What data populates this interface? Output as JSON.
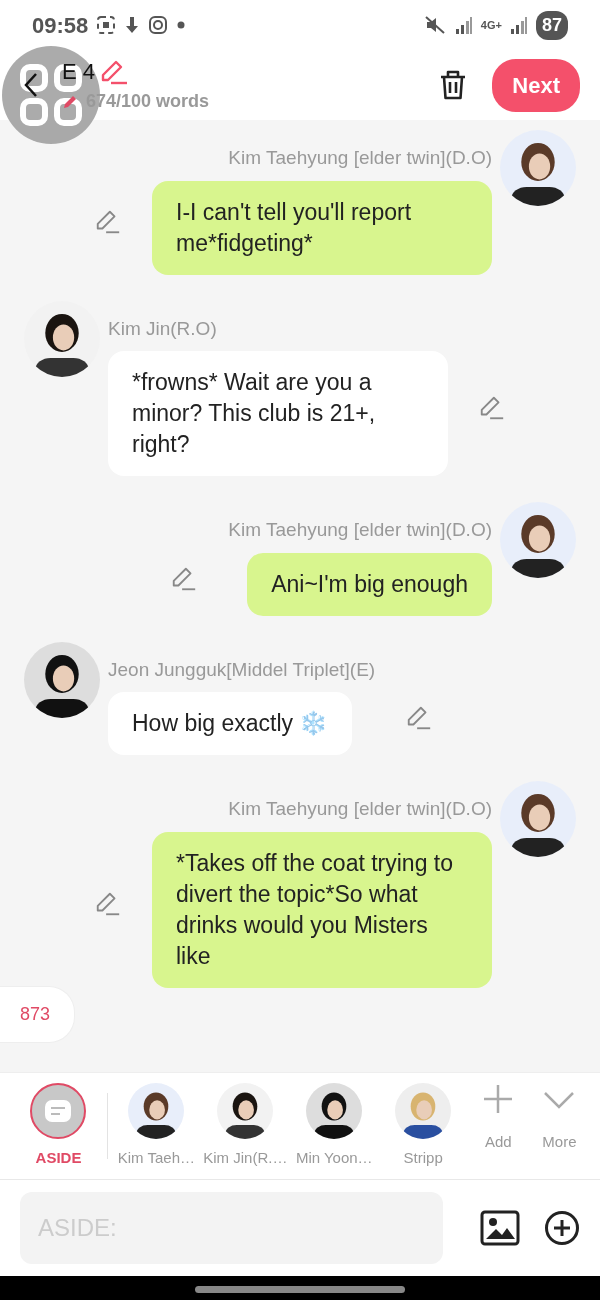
{
  "status_bar": {
    "time": "09:58",
    "network": "4G+",
    "battery": "87"
  },
  "header": {
    "title": "E 4",
    "word_count": "674/100 words",
    "next_button": "Next"
  },
  "messages": [
    {
      "kind": "outgoing",
      "name": "Kim Taehyung [elder twin](D.O)",
      "text": "I-I can't tell you'll report me*fidgeting*"
    },
    {
      "kind": "incoming",
      "name": "Kim Jin(R.O)",
      "text": "*frowns* Wait are you a minor? This club is 21+, right?"
    },
    {
      "kind": "outgoing",
      "name": "Kim Taehyung [elder twin](D.O)",
      "text": "Ani~I'm big enough"
    },
    {
      "kind": "incoming",
      "name": "Jeon Jungguk[Middel Triplet](E)",
      "text": "How big exactly ❄️"
    },
    {
      "kind": "outgoing",
      "name": "Kim Taehyung [elder twin](D.O)",
      "text": "*Takes off the coat trying to divert the topic*So what drinks would you Misters like"
    }
  ],
  "floating_counter": "873",
  "character_bar": {
    "items": [
      {
        "kind": "aside",
        "label": "ASIDE",
        "selected": true
      },
      {
        "kind": "character",
        "label": "Kim Taeh…",
        "selected": false
      },
      {
        "kind": "character",
        "label": "Kim Jin(R.…",
        "selected": false
      },
      {
        "kind": "character",
        "label": "Min Yoon…",
        "selected": false
      },
      {
        "kind": "character",
        "label": "Stripp",
        "selected": false
      }
    ],
    "add": "Add",
    "more": "More"
  },
  "input": {
    "placeholder": "ASIDE:"
  }
}
